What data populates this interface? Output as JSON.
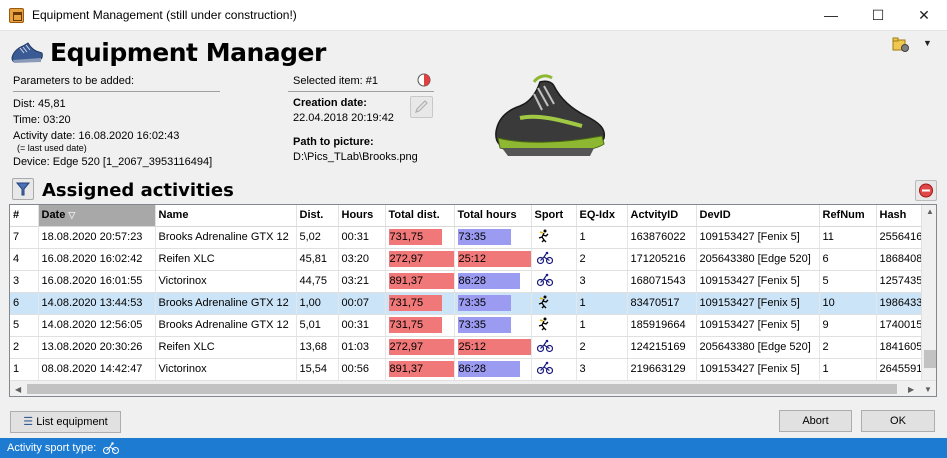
{
  "window": {
    "title": "Equipment Management (still under construction!)"
  },
  "header": {
    "title": "Equipment Manager"
  },
  "params": {
    "heading": "Parameters to be added:",
    "dist": "Dist: 45,81",
    "time": "Time: 03:20",
    "activity_date": "Activity date: 16.08.2020 16:02:43",
    "note": "(= last used date)",
    "device": "Device: Edge 520 [1_2067_3953116494]"
  },
  "selected": {
    "label": "Selected item: #1",
    "creation_label": "Creation date:",
    "creation_value": "22.04.2018 20:19:42",
    "path_label": "Path to picture:",
    "path_value": "D:\\Pics_TLab\\Brooks.png"
  },
  "assigned": {
    "title": "Assigned activities"
  },
  "table": {
    "columns": [
      "#",
      "Date",
      "Name",
      "Dist.",
      "Hours",
      "Total dist.",
      "Total hours",
      "Sport",
      "EQ-Idx",
      "ActvityID",
      "DevID",
      "RefNum",
      "Hash"
    ],
    "rows": [
      {
        "num": "7",
        "date": "18.08.2020 20:57:23",
        "name": "Brooks Adrenaline GTX 12",
        "dist": "5,02",
        "hours": "00:31",
        "total_dist": "731,75",
        "total_hours": "73:35",
        "sport": "run",
        "eq": "1",
        "activity": "163876022",
        "dev": "109153427 [Fenix 5]",
        "ref": "11",
        "hash": "2556416"
      },
      {
        "num": "4",
        "date": "16.08.2020 16:02:42",
        "name": "Reifen XLC",
        "dist": "45,81",
        "hours": "03:20",
        "total_dist": "272,97",
        "total_hours": "25:12",
        "sport": "bike",
        "eq": "2",
        "activity": "171205216",
        "dev": "205643380 [Edge 520]",
        "ref": "6",
        "hash": "1868408"
      },
      {
        "num": "3",
        "date": "16.08.2020 16:01:55",
        "name": "Victorinox",
        "dist": "44,75",
        "hours": "03:21",
        "total_dist": "891,37",
        "total_hours": "86:28",
        "sport": "bike",
        "eq": "3",
        "activity": "168071543",
        "dev": "109153427 [Fenix 5]",
        "ref": "5",
        "hash": "1257435"
      },
      {
        "num": "6",
        "date": "14.08.2020 13:44:53",
        "name": "Brooks Adrenaline GTX 12",
        "dist": "1,00",
        "hours": "00:07",
        "total_dist": "731,75",
        "total_hours": "73:35",
        "sport": "run",
        "eq": "1",
        "activity": "83470517",
        "dev": "109153427 [Fenix 5]",
        "ref": "10",
        "hash": "1986433"
      },
      {
        "num": "5",
        "date": "14.08.2020 12:56:05",
        "name": "Brooks Adrenaline GTX 12",
        "dist": "5,01",
        "hours": "00:31",
        "total_dist": "731,75",
        "total_hours": "73:35",
        "sport": "run",
        "eq": "1",
        "activity": "185919664",
        "dev": "109153427 [Fenix 5]",
        "ref": "9",
        "hash": "1740015"
      },
      {
        "num": "2",
        "date": "13.08.2020 20:30:26",
        "name": "Reifen XLC",
        "dist": "13,68",
        "hours": "01:03",
        "total_dist": "272,97",
        "total_hours": "25:12",
        "sport": "bike",
        "eq": "2",
        "activity": "124215169",
        "dev": "205643380 [Edge 520]",
        "ref": "2",
        "hash": "1841605"
      },
      {
        "num": "1",
        "date": "08.08.2020 14:42:47",
        "name": "Victorinox",
        "dist": "15,54",
        "hours": "00:56",
        "total_dist": "891,37",
        "total_hours": "86:28",
        "sport": "bike",
        "eq": "3",
        "activity": "219663129",
        "dev": "109153427 [Fenix 5]",
        "ref": "1",
        "hash": "2645591"
      }
    ],
    "selected_row": 3,
    "total_dist_fill": {
      "731,75": 0.82,
      "272,97": 1.0,
      "891,37": 1.0
    },
    "total_hours_fill": {
      "73:35": 0.73,
      "25:12": 1.0,
      "86:28": 0.85
    }
  },
  "buttons": {
    "list_equipment": "List equipment",
    "abort": "Abort",
    "ok": "OK"
  },
  "status": {
    "label": "Activity sport type:"
  },
  "colors": {
    "dist_bar": "#f07878",
    "hours_bar_blue": "#9b9bf2",
    "hours_bar_red": "#f07878",
    "selected_row": "#cce4f7",
    "status_bar": "#1e7bd2"
  },
  "icons": {
    "app": "toolbox-icon",
    "header": "running-shoe-icon",
    "run": "runner-icon",
    "bike": "cyclist-icon"
  }
}
